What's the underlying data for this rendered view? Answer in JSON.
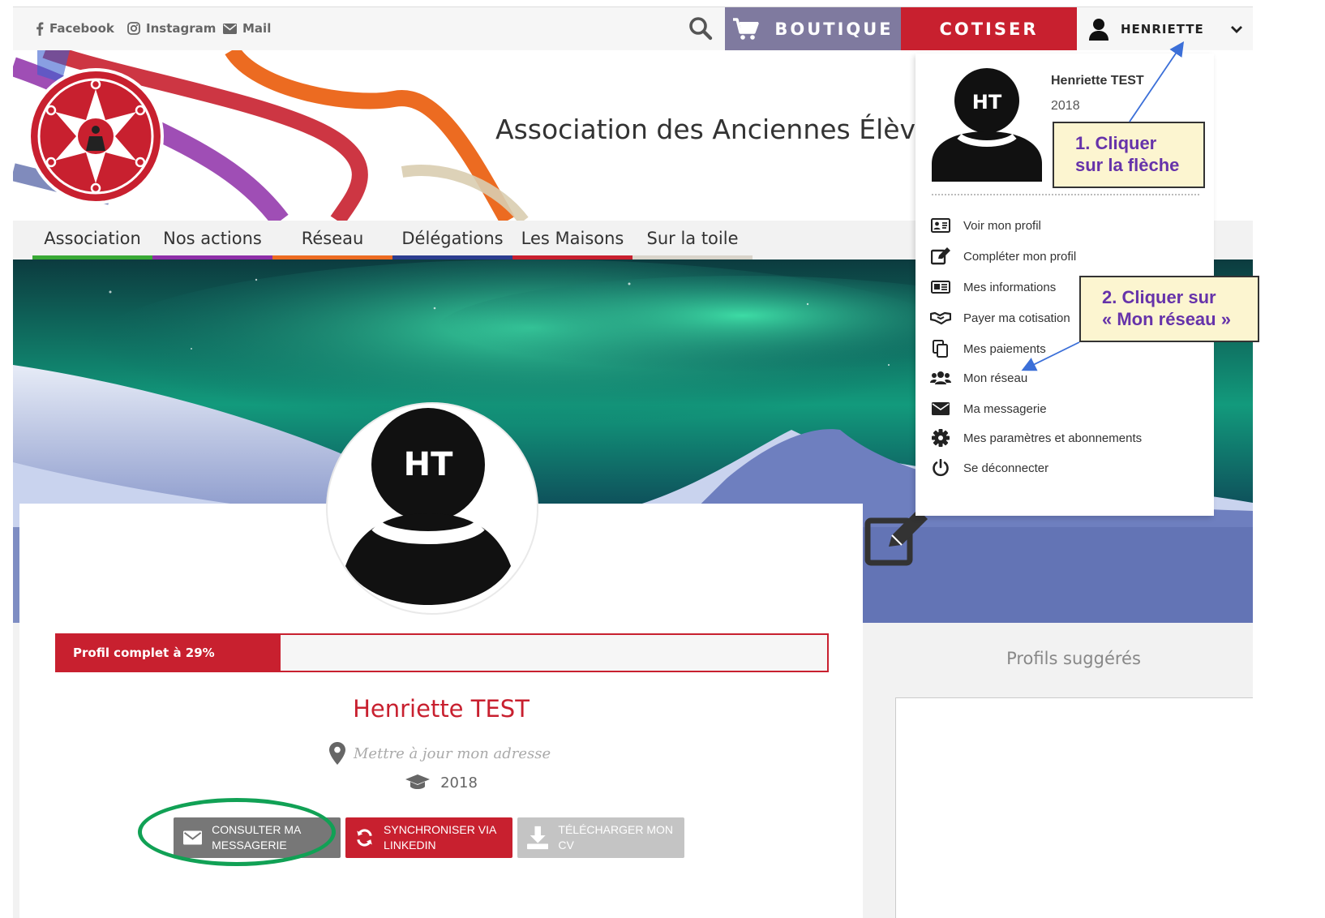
{
  "topbar": {
    "facebook": "Facebook",
    "instagram": "Instagram",
    "mail": "Mail",
    "boutique": "BOUTIQUE",
    "cotiser": "COTISER",
    "user": "HENRIETTE"
  },
  "header": {
    "title": "Association des Anciennes Élèves"
  },
  "nav": [
    {
      "label": "Association",
      "color": "#39a935"
    },
    {
      "label": "Nos actions",
      "color": "#8e2fa8"
    },
    {
      "label": "Réseau",
      "color": "#ec6b21"
    },
    {
      "label": "Délégations",
      "color": "#2c3d8f"
    },
    {
      "label": "Les Maisons",
      "color": "#c8202f"
    },
    {
      "label": "Sur la toile",
      "color": "#d9d4ca"
    }
  ],
  "profile": {
    "initials": "HT",
    "name": "Henriette TEST",
    "progress_label": "Profil complet à 29%",
    "progress": 0.29,
    "address_placeholder": "Mettre à jour mon adresse",
    "year": "2018",
    "actions": {
      "messagerie": "CONSULTER MA MESSAGERIE",
      "linkedin": "SYNCHRONISER VIA LINKEDIN",
      "cv": "TÉLÉCHARGER MON CV"
    }
  },
  "suggestions": {
    "title": "Profils suggérés"
  },
  "dropdown": {
    "initials": "HT",
    "name": "Henriette TEST",
    "year": "2018",
    "items": [
      {
        "label": "Voir mon profil",
        "icon": "id-card-icon"
      },
      {
        "label": "Compléter mon profil",
        "icon": "edit-icon"
      },
      {
        "label": "Mes informations",
        "icon": "info-card-icon"
      },
      {
        "label": "Payer ma cotisation",
        "icon": "handshake-icon"
      },
      {
        "label": "Mes paiements",
        "icon": "copy-icon"
      },
      {
        "label": "Mon réseau",
        "icon": "users-icon"
      },
      {
        "label": "Ma messagerie",
        "icon": "envelope-icon"
      },
      {
        "label": "Mes paramètres et abonnements",
        "icon": "gear-icon"
      },
      {
        "label": "Se déconnecter",
        "icon": "power-icon"
      }
    ]
  },
  "callouts": {
    "one_line1": "1. Cliquer",
    "one_line2": "sur la flèche",
    "two_line1": "2. Cliquer sur",
    "two_line2": "« Mon réseau »"
  },
  "colors": {
    "brand_red": "#c8202f",
    "boutique_purple": "#7f7a9f",
    "callout_bg": "#fcf5d0",
    "callout_text": "#6633aa",
    "highlight_green": "#11a155",
    "arrow_blue": "#3b6fd8"
  }
}
